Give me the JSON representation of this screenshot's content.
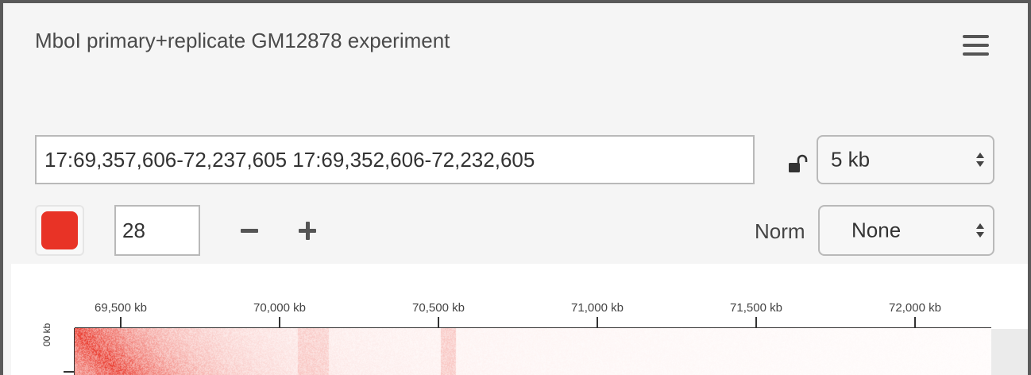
{
  "panel": {
    "title": "MboI primary+replicate GM12878 experiment"
  },
  "menu": {
    "icon": "hamburger-menu-icon"
  },
  "locus": {
    "value": "17:69,357,606-72,237,605 17:69,352,606-72,232,605"
  },
  "lock": {
    "icon": "unlocked-padlock-icon"
  },
  "resolution": {
    "selected": "5 kb"
  },
  "color": {
    "swatch_hex": "#e83326"
  },
  "color_scale": {
    "value": "28"
  },
  "norm": {
    "label": "Norm",
    "selected": "None"
  },
  "ruler": {
    "x_ticks": [
      "69,500 kb",
      "70,000 kb",
      "70,500 kb",
      "71,000 kb",
      "71,500 kb",
      "72,000 kb"
    ],
    "y_tick_partial": "00 kb"
  },
  "heatmap": {
    "base_color": "#e83326"
  }
}
